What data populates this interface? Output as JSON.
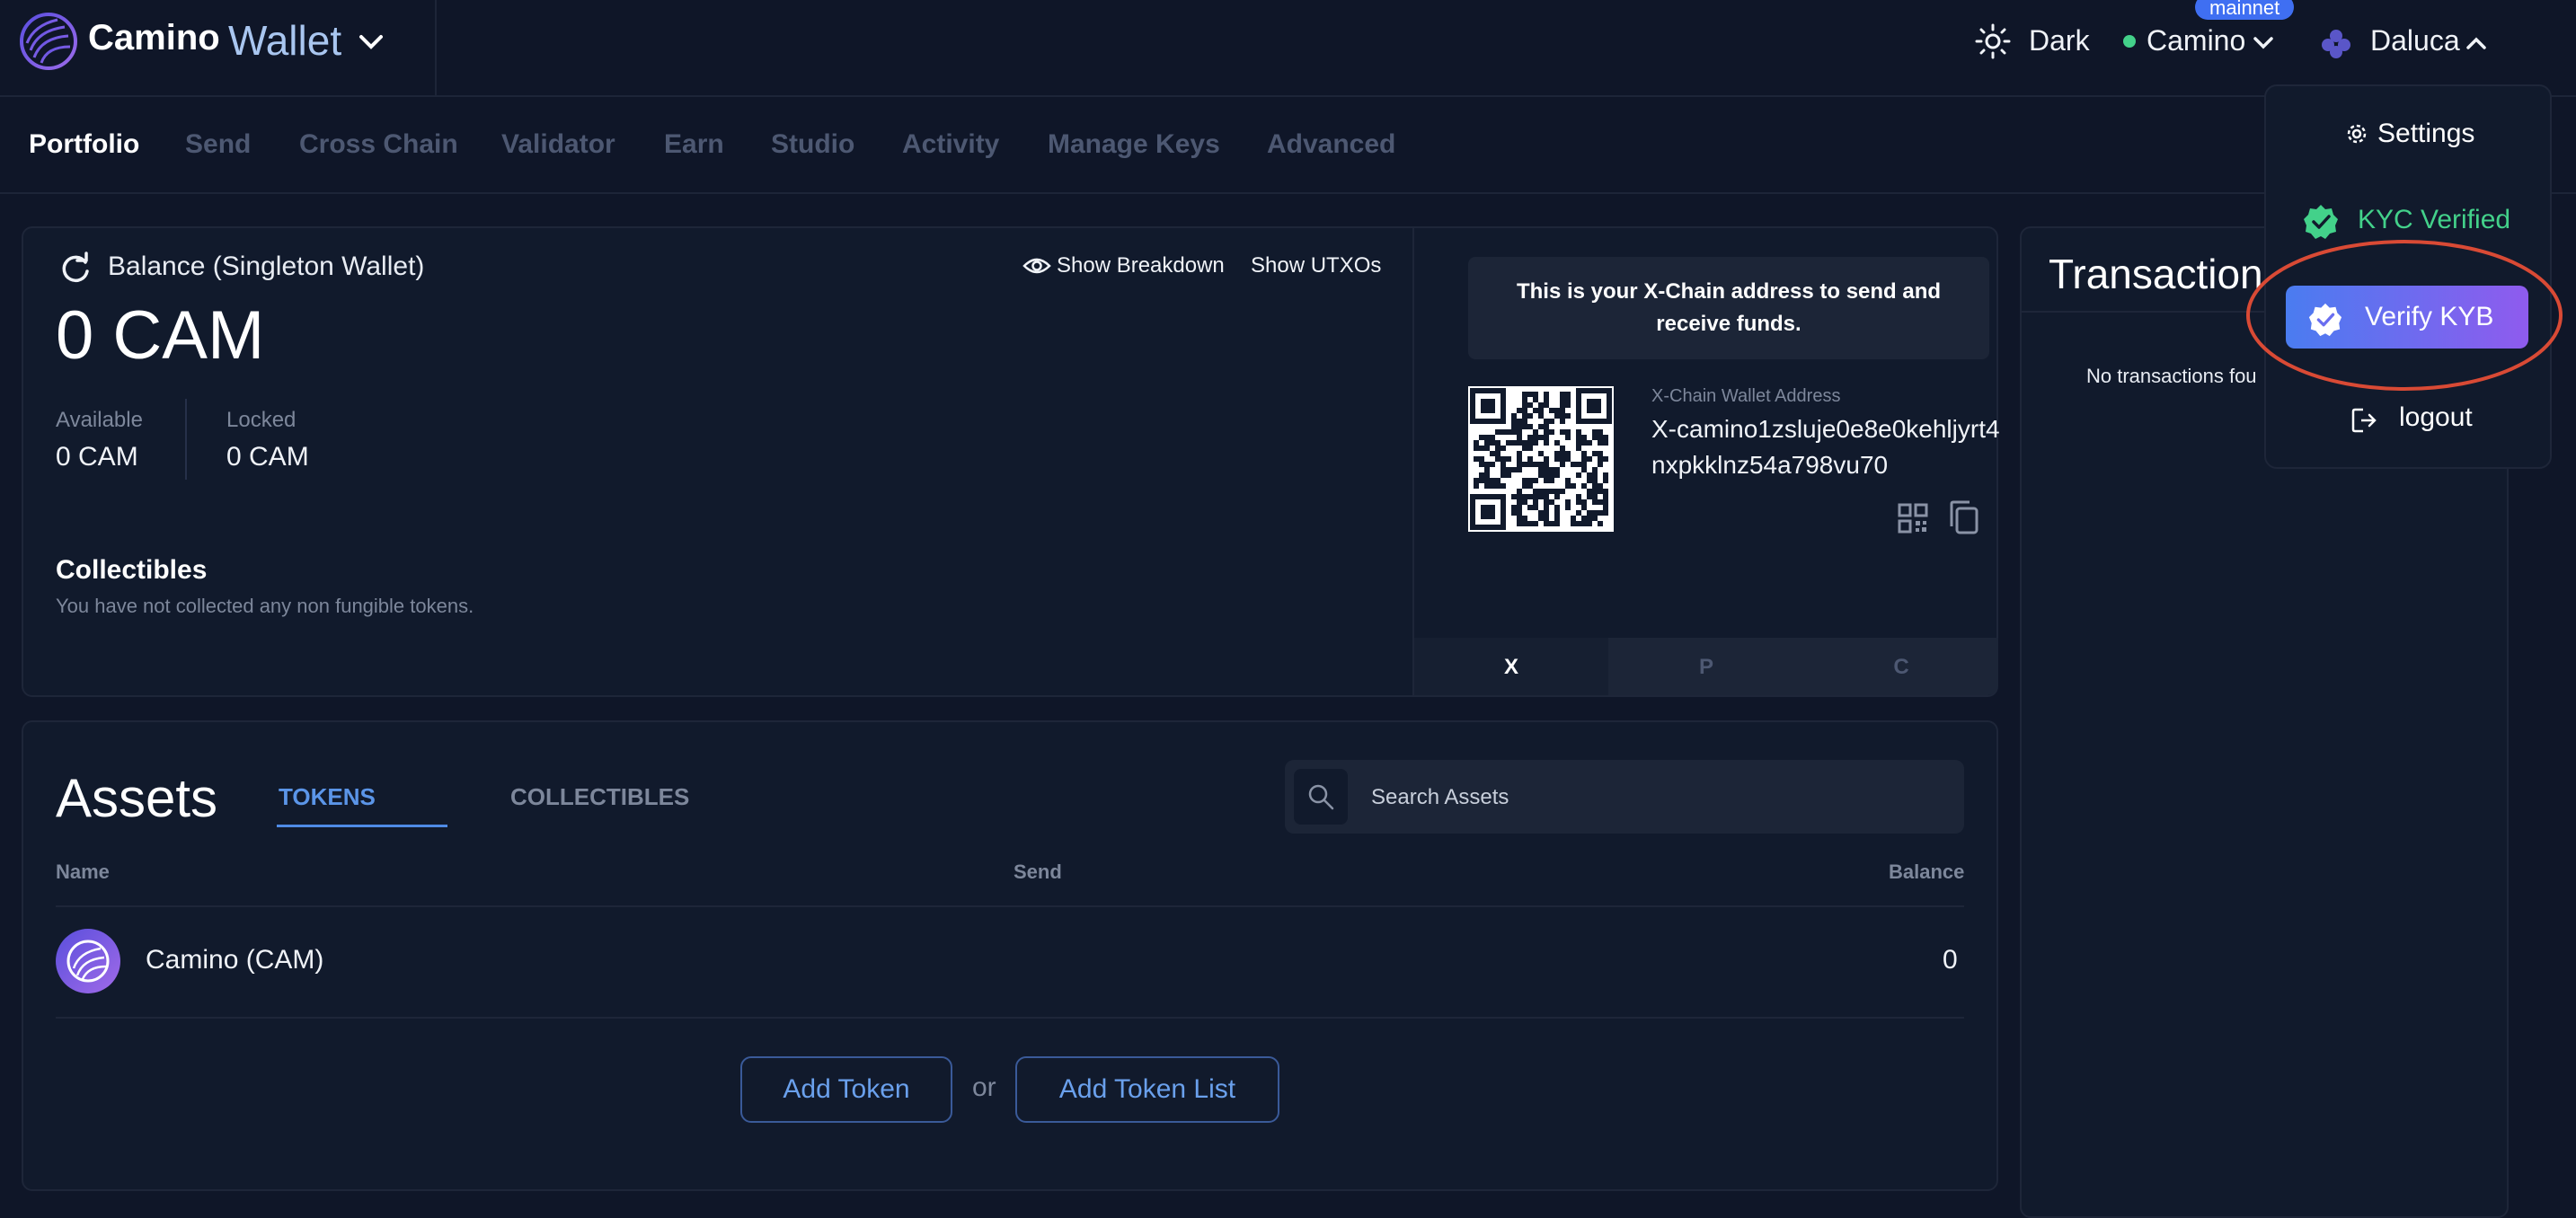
{
  "header": {
    "brand_name": "Camino",
    "brand_suffix": "Wallet",
    "theme_label": "Dark",
    "network_label": "Camino",
    "network_badge": "mainnet",
    "user_label": "Daluca"
  },
  "nav": {
    "items": [
      "Portfolio",
      "Send",
      "Cross Chain",
      "Validator",
      "Earn",
      "Studio",
      "Activity",
      "Manage Keys",
      "Advanced"
    ],
    "active": "Portfolio"
  },
  "balance": {
    "title": "Balance (Singleton Wallet)",
    "amount": "0 CAM",
    "show_breakdown": "Show Breakdown",
    "show_utxos": "Show UTXOs",
    "available_label": "Available",
    "available_value": "0 CAM",
    "locked_label": "Locked",
    "locked_value": "0 CAM",
    "collectibles_title": "Collectibles",
    "collectibles_empty": "You have not collected any non fungible tokens."
  },
  "address": {
    "info": "This is your X-Chain address to send and receive funds.",
    "label": "X-Chain Wallet Address",
    "value": "X-camino1zsluje0e8e0kehljyrt4nxpkklnz54a798vu70",
    "chain_tabs": [
      "X",
      "P",
      "C"
    ],
    "active_chain": "X"
  },
  "assets": {
    "title": "Assets",
    "tabs": [
      "TOKENS",
      "COLLECTIBLES"
    ],
    "search_placeholder": "Search Assets",
    "columns": [
      "Name",
      "Send",
      "Balance"
    ],
    "rows": [
      {
        "name": "Camino (CAM)",
        "balance": "0"
      }
    ],
    "add_token": "Add Token",
    "or": "or",
    "add_token_list": "Add Token List"
  },
  "transactions": {
    "title": "Transaction",
    "empty": "No transactions fou"
  },
  "dropdown": {
    "settings": "Settings",
    "kyc": "KYC Verified",
    "verify_kyb": "Verify KYB",
    "logout": "logout"
  },
  "colors": {
    "background": "#0f1628",
    "accent": "#4f8be6",
    "success": "#43d18a",
    "highlight": "#d94a35"
  }
}
